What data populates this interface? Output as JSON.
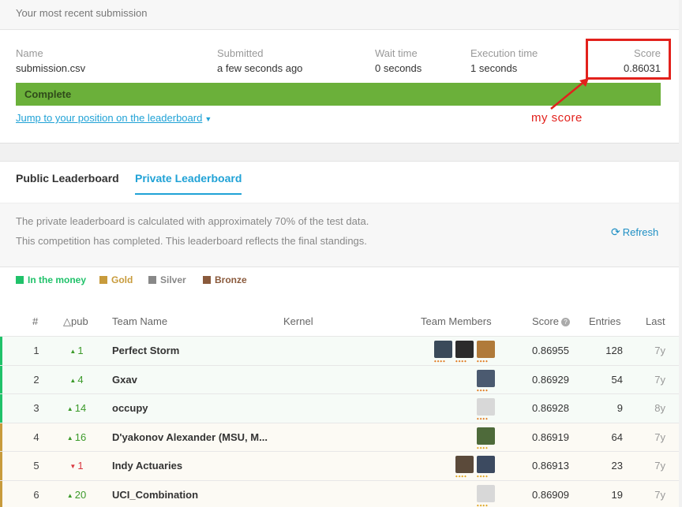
{
  "submission": {
    "section_title": "Your most recent submission",
    "name_label": "Name",
    "name_value": "submission.csv",
    "submitted_label": "Submitted",
    "submitted_value": "a few seconds ago",
    "wait_label": "Wait time",
    "wait_value": "0 seconds",
    "exec_label": "Execution time",
    "exec_value": "1 seconds",
    "score_label": "Score",
    "score_value": "0.86031",
    "status": "Complete",
    "jump_link": "Jump to your position on the leaderboard",
    "annotation": "my score"
  },
  "tabs": [
    "Public Leaderboard",
    "Private Leaderboard"
  ],
  "active_tab": "Private Leaderboard",
  "info": {
    "line1": "The private leaderboard is calculated with approximately 70% of the test data.",
    "line2": "This competition has completed. This leaderboard reflects the final standings.",
    "refresh": "Refresh"
  },
  "legend": [
    {
      "label": "In the money",
      "color": "#20c26a"
    },
    {
      "label": "Gold",
      "color": "#c89b3c"
    },
    {
      "label": "Silver",
      "color": "#888888"
    },
    {
      "label": "Bronze",
      "color": "#8a5a3c"
    }
  ],
  "columns": {
    "rank": "#",
    "delta": "△pub",
    "team": "Team Name",
    "kernel": "Kernel",
    "members": "Team Members",
    "score": "Score",
    "entries": "Entries",
    "last": "Last"
  },
  "rows": [
    {
      "rank": "1",
      "dir": "up",
      "delta": "1",
      "team": "Perfect Storm",
      "score": "0.86955",
      "entries": "128",
      "last": "7y",
      "tier": "money",
      "members": [
        "#3a4a5a",
        "#2b2b2b",
        "#b07a3a"
      ]
    },
    {
      "rank": "2",
      "dir": "up",
      "delta": "4",
      "team": "Gxav",
      "score": "0.86929",
      "entries": "54",
      "last": "7y",
      "tier": "money",
      "members": [
        "#4b5a70"
      ]
    },
    {
      "rank": "3",
      "dir": "up",
      "delta": "14",
      "team": "occupy",
      "score": "0.86928",
      "entries": "9",
      "last": "8y",
      "tier": "money",
      "members": [
        "#d8d8d8"
      ]
    },
    {
      "rank": "4",
      "dir": "up",
      "delta": "16",
      "team": "D'yakonov Alexander (MSU, M...",
      "score": "0.86919",
      "entries": "64",
      "last": "7y",
      "tier": "gold",
      "members": [
        "#4e6a3a"
      ]
    },
    {
      "rank": "5",
      "dir": "down",
      "delta": "1",
      "team": "Indy Actuaries",
      "score": "0.86913",
      "entries": "23",
      "last": "7y",
      "tier": "gold",
      "members": [
        "#5b4a3a",
        "#3c4a60"
      ]
    },
    {
      "rank": "6",
      "dir": "up",
      "delta": "20",
      "team": "UCI_Combination",
      "score": "0.86909",
      "entries": "19",
      "last": "7y",
      "tier": "gold",
      "members": [
        "#d8d8d8"
      ]
    }
  ]
}
